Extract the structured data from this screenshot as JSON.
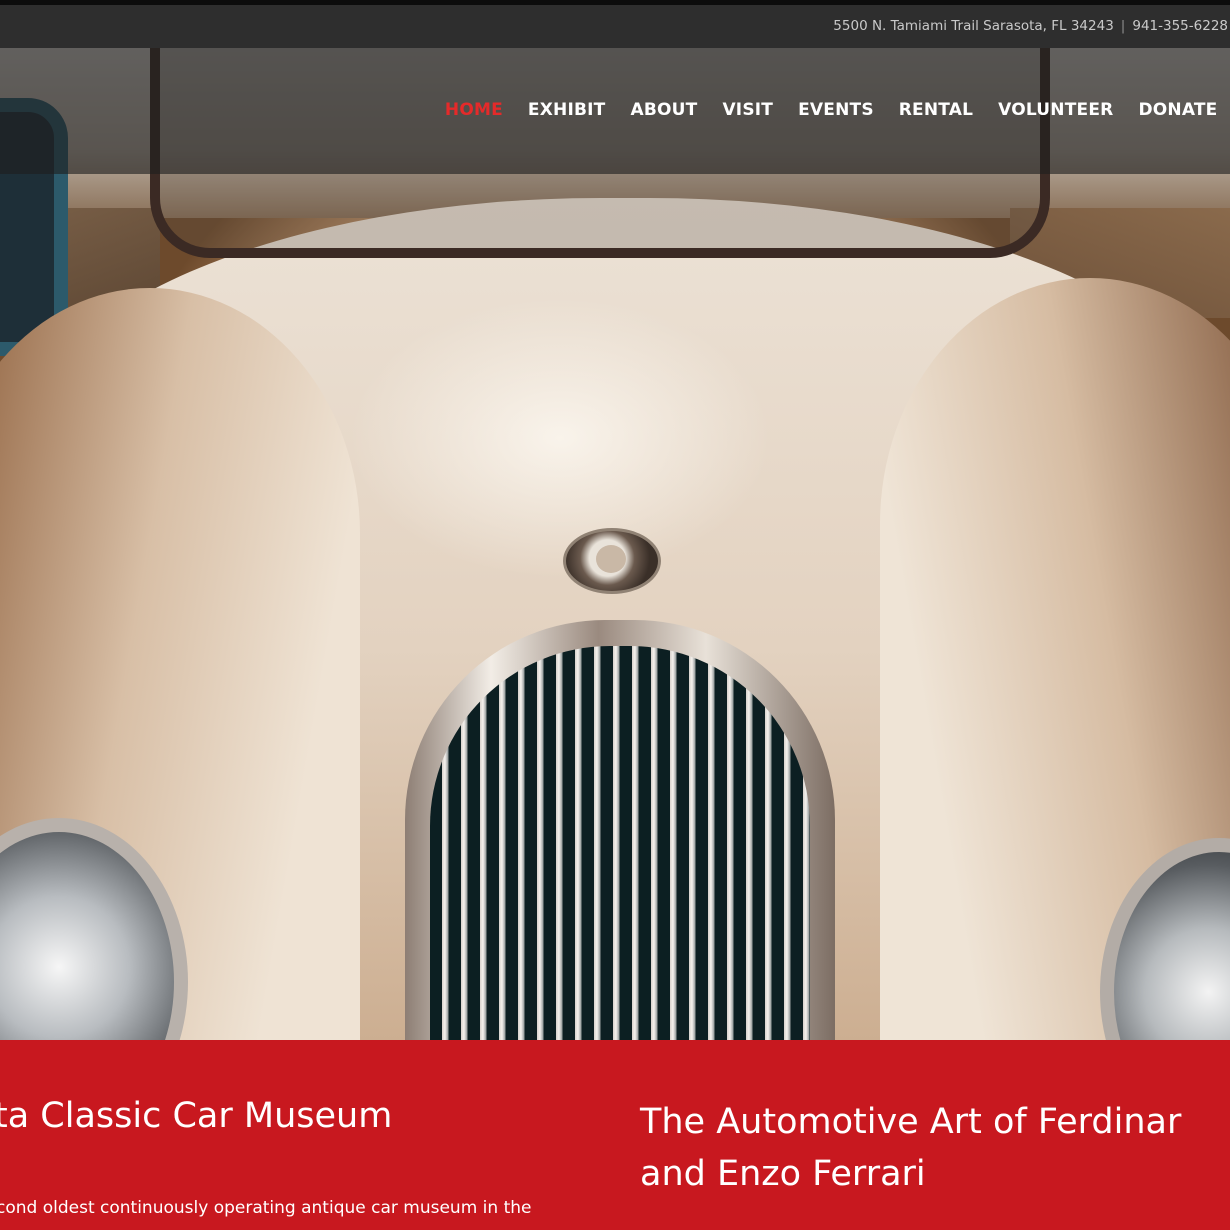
{
  "topbar": {
    "address": "5500 N. Tamiami Trail Sarasota, FL 34243",
    "separator": "|",
    "phone": "941-355-6228"
  },
  "nav": {
    "items": [
      {
        "label": "HOME",
        "active": true
      },
      {
        "label": "EXHIBIT",
        "active": false
      },
      {
        "label": "ABOUT",
        "active": false
      },
      {
        "label": "VISIT",
        "active": false
      },
      {
        "label": "EVENTS",
        "active": false
      },
      {
        "label": "RENTAL",
        "active": false
      },
      {
        "label": "VOLUNTEER",
        "active": false
      },
      {
        "label": "DONATE",
        "active": false
      }
    ]
  },
  "band": {
    "left_heading": "ta Classic Car Museum",
    "left_text": "cond oldest continuously operating antique car museum in the",
    "right_heading_line1": "The Automotive Art of Ferdinar",
    "right_heading_line2": "and Enzo Ferrari"
  },
  "colors": {
    "accent_red": "#c8181f",
    "nav_active": "#e52a2a",
    "topbar_bg": "#2e2e2e"
  }
}
